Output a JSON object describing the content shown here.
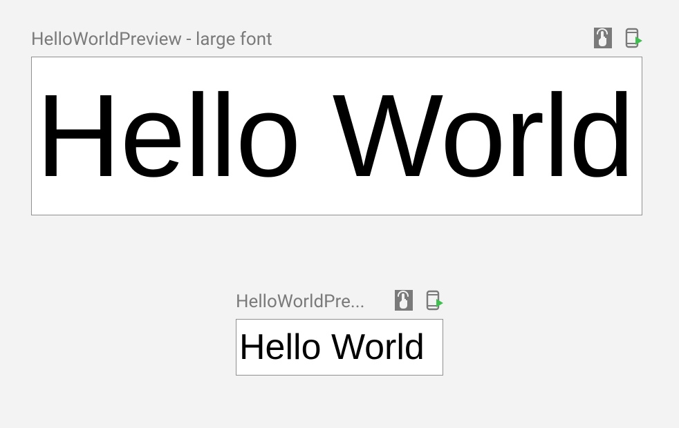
{
  "previews": [
    {
      "title": "HelloWorldPreview - large font",
      "content": "Hello World"
    },
    {
      "title": "HelloWorldPre...",
      "content": "Hello World"
    }
  ],
  "icons": {
    "interactive": "interactive-mode-icon",
    "deploy": "deploy-icon"
  }
}
